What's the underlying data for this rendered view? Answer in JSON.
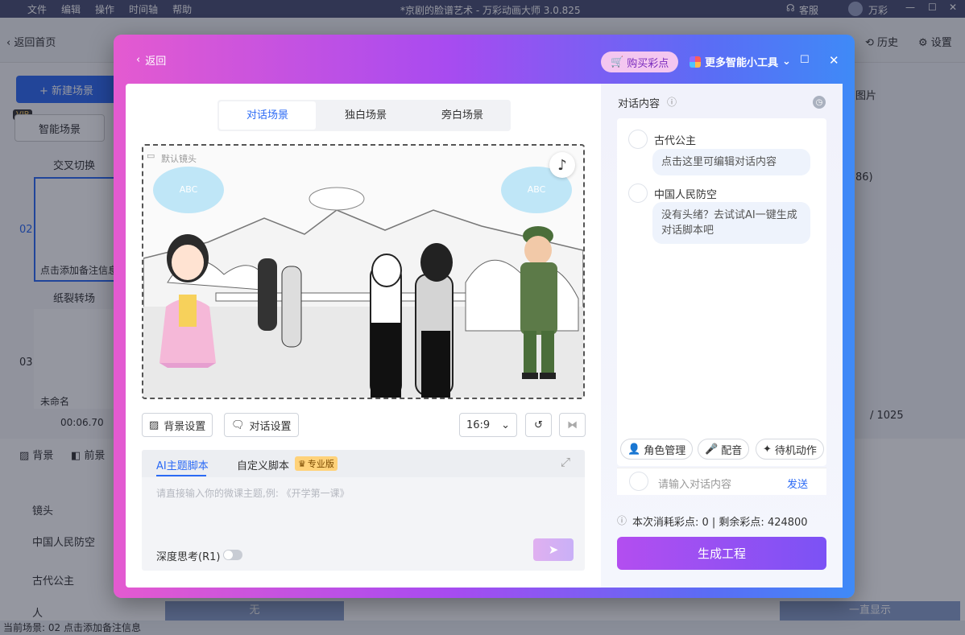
{
  "titlebar": {
    "menu": [
      "文件",
      "编辑",
      "操作",
      "时间轴",
      "帮助"
    ],
    "title": "*京剧的脸谱艺术 - 万彩动画大师 3.0.825",
    "service": "客服",
    "user": "万彩"
  },
  "bg": {
    "back_home": "返回首页",
    "history": "历史",
    "settings": "设置",
    "new_scene": "+ 新建场景",
    "smart_scene": "智能场景",
    "vip": "VIP",
    "cross_switch": "交叉切换",
    "paper_switch": "纸裂转场",
    "scene_no_2": "02",
    "scene_no_3": "03",
    "note_placeholder": "点击添加备注信息",
    "unnamed": "未命名",
    "duration": "00:06.70",
    "background": "背景",
    "foreground": "前景",
    "lens": "镜头",
    "track_1": "中国人民防空",
    "track_2": "古代公主",
    "track_3": "人",
    "none_label": "无",
    "always_show": "一直显示",
    "page_total": "/ 1025",
    "count_badge": "86)",
    "image_tab": "图片",
    "status": "当前场景: 02   点击添加备注信息"
  },
  "dialog": {
    "back": "返回",
    "buy": "购买彩点",
    "more_tools": "更多智能小工具",
    "tabs": [
      "对话场景",
      "独白场景",
      "旁白场景"
    ],
    "default_camera": "默认镜头",
    "cloud_text": "ABC",
    "bg_settings": "背景设置",
    "dialog_settings": "对话设置",
    "ratio": "16:9",
    "ai_tab": "AI主题脚本",
    "custom_tab": "自定义脚本",
    "pro_badge": "专业版",
    "ai_placeholder": "请直接输入你的微课主题,例: 《开学第一课》",
    "deep_think": "深度思考(R1)",
    "chat_title": "对话内容",
    "messages": [
      {
        "name": "古代公主",
        "text": "点击这里可编辑对话内容"
      },
      {
        "name": "中国人民防空",
        "text": "没有头绪？去试试AI一键生成对话脚本吧"
      }
    ],
    "role_manage": "角色管理",
    "dubbing": "配音",
    "idle_action": "待机动作",
    "input_placeholder": "请输入对话内容",
    "send": "发送",
    "cost": "本次消耗彩点: 0 | 剩余彩点: 424800",
    "generate": "生成工程"
  },
  "colors": {
    "accent": "#2b6af5",
    "gradient_start": "#e45ad0",
    "gradient_end": "#3f8af7"
  }
}
